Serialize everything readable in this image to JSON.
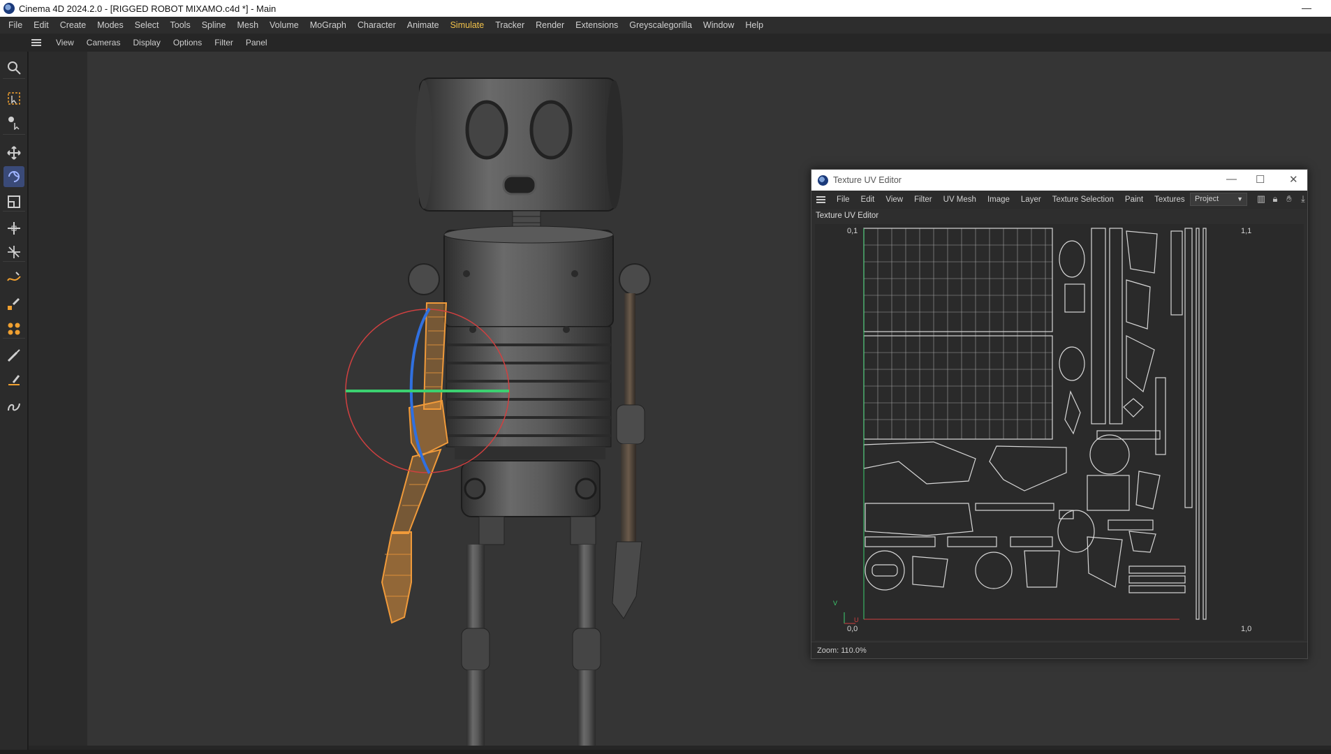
{
  "window": {
    "title": "Cinema 4D 2024.2.0 - [RIGGED ROBOT MIXAMO.c4d *] - Main"
  },
  "menubar": {
    "items": [
      "File",
      "Edit",
      "Create",
      "Modes",
      "Select",
      "Tools",
      "Spline",
      "Mesh",
      "Volume",
      "MoGraph",
      "Character",
      "Animate",
      "Simulate",
      "Tracker",
      "Render",
      "Extensions",
      "Greyscalegorilla",
      "Window",
      "Help"
    ],
    "active": "Simulate"
  },
  "viewport_menu": {
    "items": [
      "View",
      "Cameras",
      "Display",
      "Options",
      "Filter",
      "Panel"
    ]
  },
  "palette": {
    "tools": [
      {
        "name": "search-icon"
      },
      {
        "name": "live-selection-icon"
      },
      {
        "name": "selection-mode-icon"
      },
      {
        "name": "move-icon"
      },
      {
        "name": "rotate-icon",
        "active": true
      },
      {
        "name": "scale-icon"
      },
      {
        "name": "transform-icon"
      },
      {
        "name": "snap-transform-icon"
      },
      {
        "name": "spline-pen-icon"
      },
      {
        "name": "spline-sketch-icon"
      },
      {
        "name": "mograph-cloner-icon"
      },
      {
        "name": "brush-icon"
      },
      {
        "name": "pen-tool-icon"
      },
      {
        "name": "spline-smooth-icon"
      }
    ],
    "active_color": "#3a4a78"
  },
  "uv_editor": {
    "title": "Texture UV Editor",
    "menu": [
      "File",
      "Edit",
      "View",
      "Filter",
      "UV Mesh",
      "Image",
      "Layer",
      "Texture Selection",
      "Paint",
      "Textures"
    ],
    "dropdown_value": "Project",
    "subtitle": "Texture UV Editor",
    "corners": {
      "top_left": "0,1",
      "top_right": "1,1",
      "bottom_left": "0,0",
      "bottom_right": "1,0"
    },
    "axis": {
      "v": "V",
      "u": "U"
    },
    "zoom_text": "Zoom: 110.0%"
  },
  "colors": {
    "selection_orange": "#f09a3a",
    "rotate_x": "#d04040",
    "rotate_y": "#3cd070",
    "rotate_z": "#3070e0",
    "simulate_active": "#f2c24a"
  }
}
